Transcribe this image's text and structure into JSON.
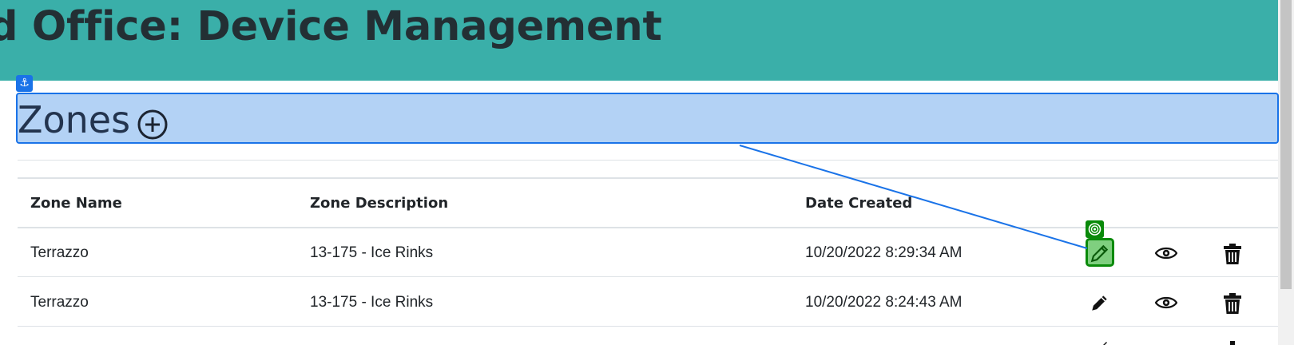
{
  "header": {
    "title": "d Office: Device Management"
  },
  "section": {
    "title": "Zones",
    "add_icon": "plus-circle-icon"
  },
  "overlay": {
    "anchor_icon": "⚓",
    "target_icon": "target-icon",
    "colors": {
      "highlight_blue": "#1a73e8",
      "highlight_green": "#0a8a0a"
    }
  },
  "table": {
    "columns": [
      "Zone Name",
      "Zone Description",
      "Date Created"
    ],
    "rows": [
      {
        "zone_name": "Terrazzo",
        "zone_description": "13-175 - Ice Rinks",
        "date_created": "10/20/2022 8:29:34 AM"
      },
      {
        "zone_name": "Terrazzo",
        "zone_description": "13-175 - Ice Rinks",
        "date_created": "10/20/2022 8:24:43 AM"
      }
    ],
    "row_actions": [
      "pencil-icon",
      "eye-icon",
      "trash-icon"
    ]
  },
  "colors": {
    "header_bg": "#3aafa9",
    "title_text": "#232f34"
  }
}
